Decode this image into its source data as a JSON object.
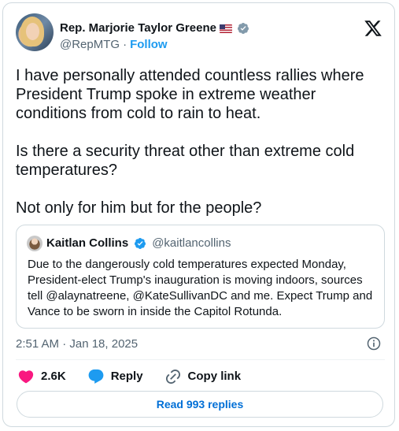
{
  "author": {
    "name": "Rep. Marjorie Taylor Greene",
    "handle": "@RepMTG",
    "separator": "·",
    "follow_label": "Follow"
  },
  "tweet": {
    "text": "I have personally attended countless rallies where\nPresident Trump spoke in extreme weather\nconditions from cold to rain to heat.\n\nIs there a security threat other than extreme cold\ntemperatures?\n\nNot only for him but for the people?"
  },
  "quote": {
    "name": "Kaitlan Collins",
    "handle": "@kaitlancollins",
    "text": "Due to the dangerously cold temperatures expected Monday, President-elect Trump's inauguration is moving indoors, sources tell @alaynatreene, @KateSullivanDC and me. Expect Trump and Vance to be sworn in inside the Capitol Rotunda."
  },
  "meta": {
    "timestamp": "2:51 AM · Jan 18, 2025"
  },
  "actions": {
    "likes": "2.6K",
    "reply_label": "Reply",
    "copy_link_label": "Copy link",
    "read_replies_label": "Read 993 replies"
  },
  "colors": {
    "accent": "#1d9bf0",
    "like": "#f91880",
    "text": "#0f1419",
    "secondary": "#536471"
  },
  "icons": [
    "x-logo-icon",
    "verified-badge-icon",
    "us-flag-icon",
    "info-icon",
    "heart-icon",
    "reply-bubble-icon",
    "link-icon"
  ]
}
